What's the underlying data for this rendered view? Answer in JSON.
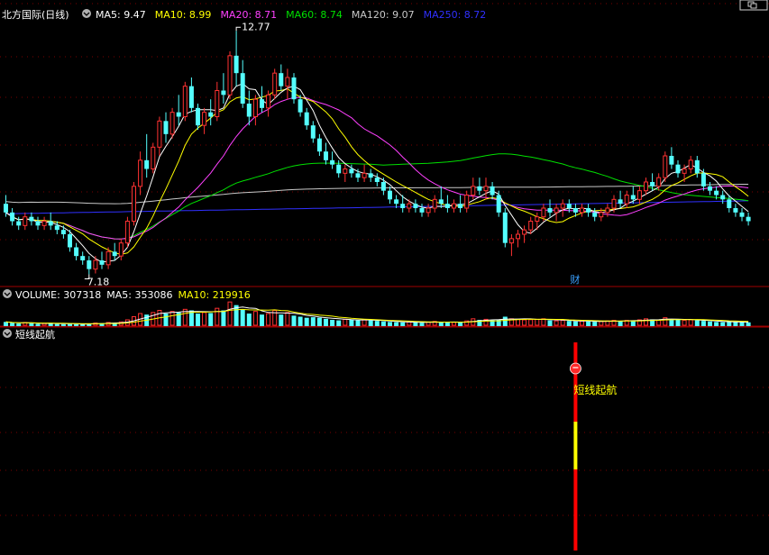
{
  "header": {
    "stock_label": "北方国际(日线)",
    "ma_labels": [
      {
        "text": "MA5: 9.47",
        "color": "#ffffff"
      },
      {
        "text": "MA10: 8.99",
        "color": "#ffff00"
      },
      {
        "text": "MA20: 8.71",
        "color": "#ff40ff"
      },
      {
        "text": "MA60: 8.74",
        "color": "#00e000"
      },
      {
        "text": "MA120: 9.07",
        "color": "#c8c8c8"
      },
      {
        "text": "MA250: 8.72",
        "color": "#3030ff"
      }
    ]
  },
  "annotations": {
    "high": "12.77",
    "low": "7.18",
    "financial_marker": "财"
  },
  "volume_pane": {
    "labels": [
      {
        "text": "VOLUME: 307318",
        "color": "#ffffff"
      },
      {
        "text": "MA5: 353086",
        "color": "#ffffff"
      },
      {
        "text": "MA10: 219916",
        "color": "#ffff00"
      }
    ]
  },
  "indicator_pane": {
    "title": "短线起航",
    "signal_label": "短线起航"
  },
  "colors": {
    "up": "#ff3232",
    "down": "#54ffff",
    "grid": "#7a0000",
    "border": "#a00000",
    "signal_bar": "#ff0000",
    "signal_bar_mid": "#ffff00",
    "signal_text": "#ffff00"
  },
  "icons": {
    "pane_menu": "chevron-down-icon",
    "window_control": "window-restore-icon",
    "signal": "signal-ball-icon"
  },
  "chart_data": {
    "type": "candlestick",
    "candles": [
      [
        8.8,
        9.0,
        8.5,
        8.6
      ],
      [
        8.6,
        8.7,
        8.3,
        8.4
      ],
      [
        8.4,
        8.5,
        8.2,
        8.3
      ],
      [
        8.3,
        8.6,
        8.2,
        8.5
      ],
      [
        8.5,
        8.6,
        8.3,
        8.4
      ],
      [
        8.4,
        8.5,
        8.2,
        8.3
      ],
      [
        8.3,
        8.5,
        8.2,
        8.4
      ],
      [
        8.4,
        8.6,
        8.2,
        8.3
      ],
      [
        8.3,
        8.4,
        8.1,
        8.2
      ],
      [
        8.2,
        8.3,
        8.0,
        8.1
      ],
      [
        8.1,
        8.2,
        7.7,
        7.8
      ],
      [
        7.8,
        7.9,
        7.5,
        7.6
      ],
      [
        7.6,
        7.7,
        7.4,
        7.5
      ],
      [
        7.5,
        7.6,
        7.18,
        7.3
      ],
      [
        7.3,
        7.6,
        7.2,
        7.5
      ],
      [
        7.5,
        7.7,
        7.3,
        7.4
      ],
      [
        7.4,
        7.8,
        7.3,
        7.7
      ],
      [
        7.7,
        7.9,
        7.5,
        7.6
      ],
      [
        7.6,
        8.0,
        7.5,
        7.9
      ],
      [
        7.9,
        8.5,
        7.8,
        8.4
      ],
      [
        8.4,
        9.3,
        8.3,
        9.2
      ],
      [
        9.2,
        10.0,
        9.0,
        9.8
      ],
      [
        9.8,
        10.4,
        9.4,
        9.6
      ],
      [
        9.6,
        10.2,
        9.5,
        10.1
      ],
      [
        10.1,
        10.8,
        9.9,
        10.7
      ],
      [
        10.7,
        10.9,
        10.2,
        10.4
      ],
      [
        10.4,
        11.0,
        10.3,
        10.9
      ],
      [
        10.9,
        11.3,
        10.6,
        10.8
      ],
      [
        10.8,
        11.6,
        10.7,
        11.5
      ],
      [
        11.5,
        11.7,
        10.9,
        11.0
      ],
      [
        11.0,
        11.1,
        10.5,
        10.6
      ],
      [
        10.6,
        11.0,
        10.4,
        10.9
      ],
      [
        10.9,
        11.2,
        10.6,
        10.8
      ],
      [
        10.8,
        11.6,
        10.7,
        11.4
      ],
      [
        11.4,
        11.8,
        11.1,
        11.3
      ],
      [
        11.3,
        12.3,
        11.2,
        12.2
      ],
      [
        12.2,
        12.77,
        11.5,
        11.8
      ],
      [
        11.8,
        12.1,
        11.0,
        11.1
      ],
      [
        11.1,
        11.4,
        10.6,
        10.8
      ],
      [
        10.8,
        11.3,
        10.6,
        11.2
      ],
      [
        11.2,
        11.5,
        10.9,
        11.0
      ],
      [
        11.0,
        11.4,
        10.8,
        11.3
      ],
      [
        11.3,
        11.9,
        11.2,
        11.8
      ],
      [
        11.8,
        12.0,
        11.4,
        11.5
      ],
      [
        11.5,
        11.9,
        11.2,
        11.7
      ],
      [
        11.7,
        11.8,
        11.1,
        11.2
      ],
      [
        11.2,
        11.3,
        10.8,
        10.9
      ],
      [
        10.9,
        11.0,
        10.5,
        10.6
      ],
      [
        10.6,
        10.7,
        10.2,
        10.3
      ],
      [
        10.3,
        10.4,
        9.9,
        10.0
      ],
      [
        10.0,
        10.2,
        9.7,
        9.8
      ],
      [
        9.8,
        10.0,
        9.6,
        9.7
      ],
      [
        9.7,
        9.8,
        9.4,
        9.5
      ],
      [
        9.5,
        9.7,
        9.3,
        9.6
      ],
      [
        9.6,
        9.7,
        9.4,
        9.5
      ],
      [
        9.5,
        9.6,
        9.3,
        9.4
      ],
      [
        9.4,
        9.7,
        9.3,
        9.5
      ],
      [
        9.5,
        9.6,
        9.3,
        9.4
      ],
      [
        9.4,
        9.5,
        9.2,
        9.3
      ],
      [
        9.3,
        9.4,
        9.0,
        9.1
      ],
      [
        9.1,
        9.2,
        8.8,
        8.9
      ],
      [
        8.9,
        9.0,
        8.7,
        8.8
      ],
      [
        8.8,
        9.0,
        8.6,
        8.7
      ],
      [
        8.7,
        8.9,
        8.6,
        8.8
      ],
      [
        8.8,
        8.9,
        8.6,
        8.7
      ],
      [
        8.7,
        8.8,
        8.5,
        8.6
      ],
      [
        8.6,
        8.8,
        8.5,
        8.7
      ],
      [
        8.7,
        9.0,
        8.6,
        8.9
      ],
      [
        8.9,
        9.2,
        8.7,
        8.8
      ],
      [
        8.8,
        9.0,
        8.6,
        8.7
      ],
      [
        8.7,
        8.9,
        8.6,
        8.8
      ],
      [
        8.8,
        9.0,
        8.6,
        8.7
      ],
      [
        8.7,
        9.1,
        8.6,
        9.0
      ],
      [
        9.0,
        9.4,
        8.9,
        9.2
      ],
      [
        9.2,
        9.4,
        9.0,
        9.1
      ],
      [
        9.1,
        9.4,
        8.9,
        9.2
      ],
      [
        9.2,
        9.3,
        8.9,
        9.0
      ],
      [
        9.0,
        9.1,
        8.5,
        8.6
      ],
      [
        8.6,
        8.7,
        7.8,
        7.9
      ],
      [
        7.9,
        8.1,
        7.6,
        8.0
      ],
      [
        8.0,
        8.2,
        7.8,
        8.1
      ],
      [
        8.1,
        8.3,
        7.9,
        8.2
      ],
      [
        8.2,
        8.5,
        8.1,
        8.4
      ],
      [
        8.4,
        8.6,
        8.2,
        8.5
      ],
      [
        8.5,
        8.8,
        8.4,
        8.7
      ],
      [
        8.7,
        8.9,
        8.5,
        8.6
      ],
      [
        8.6,
        8.8,
        8.4,
        8.7
      ],
      [
        8.7,
        8.9,
        8.5,
        8.8
      ],
      [
        8.8,
        8.9,
        8.6,
        8.7
      ],
      [
        8.7,
        8.8,
        8.5,
        8.6
      ],
      [
        8.6,
        8.8,
        8.5,
        8.7
      ],
      [
        8.7,
        8.8,
        8.5,
        8.6
      ],
      [
        8.6,
        8.7,
        8.4,
        8.5
      ],
      [
        8.5,
        8.7,
        8.4,
        8.6
      ],
      [
        8.6,
        8.8,
        8.5,
        8.7
      ],
      [
        8.7,
        9.0,
        8.6,
        8.9
      ],
      [
        8.9,
        9.1,
        8.7,
        8.8
      ],
      [
        8.8,
        9.1,
        8.7,
        9.0
      ],
      [
        9.0,
        9.2,
        8.8,
        8.9
      ],
      [
        8.9,
        9.2,
        8.8,
        9.1
      ],
      [
        9.1,
        9.4,
        9.0,
        9.3
      ],
      [
        9.3,
        9.5,
        9.1,
        9.2
      ],
      [
        9.2,
        9.5,
        9.1,
        9.4
      ],
      [
        9.4,
        10.0,
        9.3,
        9.9
      ],
      [
        9.9,
        10.1,
        9.6,
        9.7
      ],
      [
        9.7,
        9.8,
        9.4,
        9.5
      ],
      [
        9.5,
        9.7,
        9.3,
        9.6
      ],
      [
        9.6,
        9.9,
        9.5,
        9.8
      ],
      [
        9.8,
        9.9,
        9.4,
        9.5
      ],
      [
        9.5,
        9.6,
        9.1,
        9.2
      ],
      [
        9.2,
        9.3,
        9.0,
        9.1
      ],
      [
        9.1,
        9.2,
        8.9,
        9.0
      ],
      [
        9.0,
        9.1,
        8.8,
        8.9
      ],
      [
        8.9,
        9.0,
        8.6,
        8.7
      ],
      [
        8.7,
        8.8,
        8.5,
        8.6
      ],
      [
        8.6,
        8.7,
        8.4,
        8.5
      ],
      [
        8.5,
        8.6,
        8.3,
        8.4
      ]
    ],
    "volume": [
      40,
      30,
      25,
      35,
      28,
      22,
      25,
      30,
      20,
      18,
      22,
      20,
      18,
      25,
      30,
      28,
      35,
      30,
      40,
      60,
      90,
      120,
      110,
      130,
      150,
      120,
      140,
      130,
      160,
      150,
      120,
      130,
      125,
      170,
      150,
      230,
      200,
      160,
      120,
      140,
      110,
      120,
      150,
      110,
      130,
      100,
      90,
      80,
      85,
      80,
      70,
      60,
      55,
      65,
      60,
      55,
      60,
      55,
      50,
      45,
      40,
      38,
      36,
      40,
      35,
      32,
      38,
      45,
      40,
      38,
      36,
      35,
      50,
      70,
      60,
      65,
      55,
      60,
      90,
      70,
      65,
      60,
      62,
      65,
      70,
      55,
      50,
      55,
      50,
      45,
      48,
      45,
      42,
      45,
      50,
      55,
      50,
      55,
      50,
      60,
      70,
      65,
      60,
      80,
      65,
      60,
      55,
      60,
      55,
      50,
      45,
      40,
      38,
      42,
      40,
      38,
      36
    ],
    "price_range": [
      6.9,
      12.9
    ],
    "volume_max": 240,
    "signal_index": 89
  }
}
